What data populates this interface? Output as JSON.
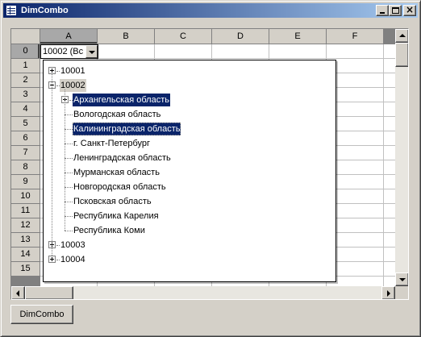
{
  "window": {
    "title": "DimCombo",
    "icon": "app-window-icon",
    "controls": {
      "minimize": "minimize-icon",
      "maximize": "maximize-icon",
      "close": "close-icon",
      "close_glyph": "×"
    }
  },
  "grid": {
    "columns": [
      "A",
      "B",
      "C",
      "D",
      "E",
      "F"
    ],
    "rows": [
      "0",
      "1",
      "2",
      "3",
      "4",
      "5",
      "6",
      "7",
      "8",
      "9",
      "10",
      "11",
      "12",
      "13",
      "14",
      "15"
    ],
    "selected_column": "A",
    "selected_row": "0"
  },
  "combo": {
    "value": "10002 (Вс",
    "icon": "chevron-down-icon"
  },
  "tree": {
    "nodes": [
      {
        "label": "10001",
        "expanded": false
      },
      {
        "label": "10002",
        "expanded": true,
        "children": [
          {
            "label": "Архангельская область",
            "expandable": true,
            "highlighted": true
          },
          {
            "label": "Вологодская область"
          },
          {
            "label": "Калининградская область",
            "highlighted": true,
            "focused": true
          },
          {
            "label": "г. Санкт-Петербург"
          },
          {
            "label": "Ленинградская область"
          },
          {
            "label": "Мурманская область"
          },
          {
            "label": "Новгородская область"
          },
          {
            "label": "Псковская область"
          },
          {
            "label": "Республика Карелия"
          },
          {
            "label": "Республика Коми"
          }
        ]
      },
      {
        "label": "10003",
        "expanded": false
      },
      {
        "label": "10004",
        "expanded": false
      }
    ]
  },
  "buttons": {
    "dimcombo": "DimCombo"
  },
  "colors": {
    "selection": "#0a246a",
    "titlebar_start": "#0a246a",
    "titlebar_end": "#a6caf0",
    "face": "#d4d0c8"
  }
}
